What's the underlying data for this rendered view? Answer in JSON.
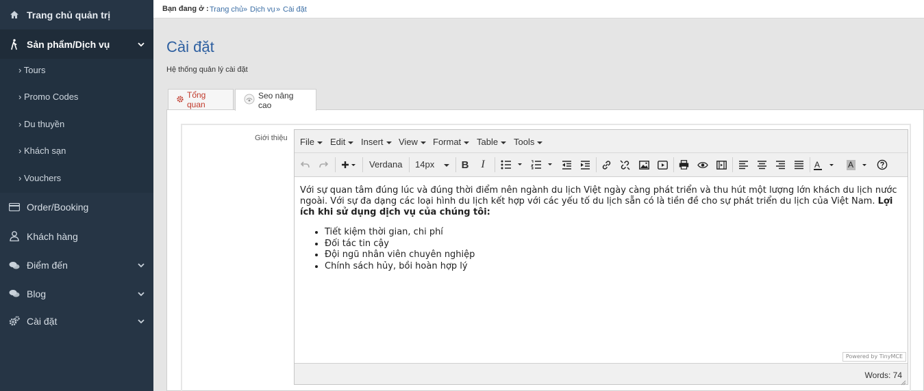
{
  "sidebar": {
    "home": "Trang chủ quản trị",
    "products": "Sản phẩm/Dịch vụ",
    "sub_items": [
      "Tours",
      "Promo Codes",
      "Du thuyền",
      "Khách sạn",
      "Vouchers"
    ],
    "orders": "Order/Booking",
    "customers": "Khách hàng",
    "destinations": "Điểm đến",
    "blog": "Blog",
    "settings": "Cài đặt"
  },
  "breadcrumb": {
    "prefix": "Bạn đang ở :",
    "items": [
      "Trang chủ",
      "Dịch vụ",
      "Cài đặt"
    ],
    "separator": "»"
  },
  "page": {
    "title": "Cài đặt",
    "subtitle": "Hệ thống quản lý cài đặt"
  },
  "tabs": [
    {
      "label": "Tổng quan",
      "active": false
    },
    {
      "label": "Seo nâng cao",
      "active": true
    }
  ],
  "form": {
    "field_label": "Giới thiệu"
  },
  "editor": {
    "menu": [
      "File",
      "Edit",
      "Insert",
      "View",
      "Format",
      "Table",
      "Tools"
    ],
    "font_family": "Verdana",
    "font_size": "14px",
    "paragraph": "Với sự quan tâm đúng lúc và đúng thời điểm nên ngành du lịch Việt ngày càng phát triển và thu hút một lượng lớn khách du lịch nước ngoài. Với sự đa dạng các loại hình du lịch kết hợp với các yếu tố du lịch sẵn có là tiền đề cho sự phát triển du lịch của Việt Nam. ",
    "bold_text": "Lợi ích khi sử dụng dịch vụ của chúng tôi:",
    "list": [
      "Tiết kiệm thời gian, chi phí",
      "Đối tác tin cậy",
      "Đội ngũ nhân viên chuyên nghiệp",
      "Chính sách hủy, bồi hoàn hợp lý"
    ],
    "powered_by": "Powered by TinyMCE",
    "word_count": "Words: 74"
  },
  "colors": {
    "sidebar_bg": "#263545",
    "title_blue": "#2d5fa0",
    "tab_icon_red": "#c0392b"
  }
}
